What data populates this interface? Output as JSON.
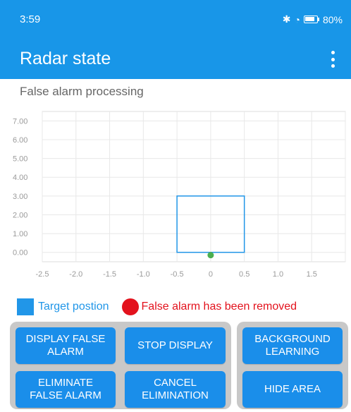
{
  "status_bar": {
    "time": "3:59",
    "battery": "80%"
  },
  "app_bar": {
    "title": "Radar state"
  },
  "section": {
    "title": "False alarm processing"
  },
  "chart_data": {
    "type": "scatter",
    "x_ticks": [
      "-2.5",
      "-2.0",
      "-1.5",
      "-1.0",
      "-0.5",
      "0",
      "0.5",
      "1.0",
      "1.5"
    ],
    "y_ticks": [
      "0.00",
      "1.00",
      "2.00",
      "3.00",
      "4.00",
      "5.00",
      "6.00",
      "7.00"
    ],
    "xlim": [
      -2.5,
      2.0
    ],
    "ylim": [
      -0.5,
      7.5
    ],
    "grid": true,
    "target_area": {
      "x_min": -0.5,
      "x_max": 0.5,
      "y_min": 0.0,
      "y_max": 3.0
    },
    "points": [
      {
        "x": 0.0,
        "y": -0.15
      }
    ]
  },
  "legend": {
    "target_label": "Target postion",
    "removed_label": "False alarm has been removed"
  },
  "buttons": {
    "display_false_alarm": "DISPLAY FALSE\nALARM",
    "stop_display": "STOP DISPLAY",
    "background_learning": "BACKGROUND\nLEARNING",
    "eliminate_false_alarm": "ELIMINATE\nFALSE ALARM",
    "cancel_elimination": "CANCEL\nELIMINATION",
    "hide_area": "HIDE AREA"
  },
  "colors": {
    "primary": "#1896e8",
    "target": "#2196e8",
    "removed": "#e3121d",
    "point": "#4caf50",
    "panel": "#c8c8c8"
  }
}
